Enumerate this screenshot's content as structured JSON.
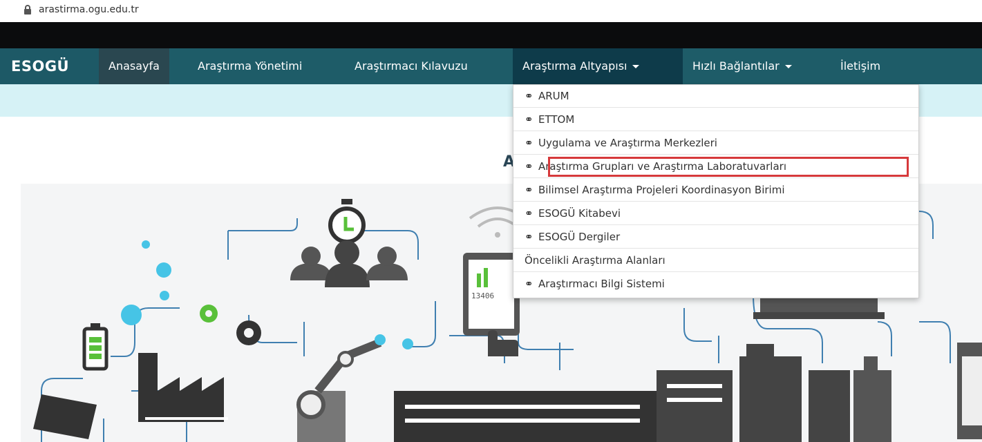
{
  "browser": {
    "url": "arastirma.ogu.edu.tr"
  },
  "nav": {
    "brand": "ESOGÜ",
    "items": [
      {
        "label": "Anasayfa"
      },
      {
        "label": "Araştırma Yönetimi"
      },
      {
        "label": "Araştırmacı Kılavuzu"
      },
      {
        "label": "Araştırma Altyapısı"
      },
      {
        "label": "Hızlı Bağlantılar"
      },
      {
        "label": "İletişim"
      }
    ]
  },
  "heading_fragment": "A",
  "dropdown": {
    "items": [
      {
        "label": "ARUM",
        "icon": "link-icon"
      },
      {
        "label": "ETTOM",
        "icon": "link-icon"
      },
      {
        "label": "Uygulama ve Araştırma Merkezleri",
        "icon": "link-icon"
      },
      {
        "label": "Araştırma Grupları ve Araştırma Laboratuvarları",
        "icon": "link-icon"
      },
      {
        "label": "Bilimsel Araştırma Projeleri Koordinasyon Birimi",
        "icon": "link-icon"
      },
      {
        "label": "ESOGÜ Kitabevi",
        "icon": "link-icon"
      },
      {
        "label": "ESOGÜ Dergiler",
        "icon": "link-icon"
      },
      {
        "label": "Öncelikli Araştırma Alanları",
        "icon": ""
      },
      {
        "label": "Araştırmacı Bilgi Sistemi",
        "icon": "link-icon"
      }
    ]
  },
  "hero": {
    "counter_text": "13406"
  },
  "colors": {
    "nav": "#1e5c68",
    "subbar": "#d6f2f6",
    "highlight": "#d6393b",
    "accent_green": "#59c03a",
    "accent_blue": "#46c4e6"
  }
}
